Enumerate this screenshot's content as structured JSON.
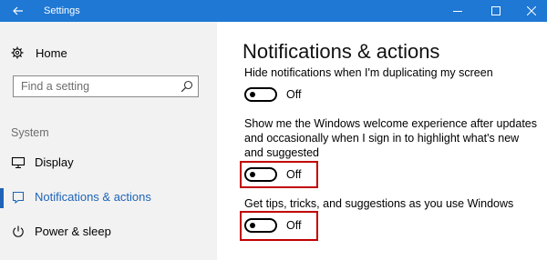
{
  "window": {
    "title": "Settings"
  },
  "sidebar": {
    "home_label": "Home",
    "search_placeholder": "Find a setting",
    "section_label": "System",
    "items": [
      {
        "label": "Display"
      },
      {
        "label": "Notifications & actions"
      },
      {
        "label": "Power & sleep"
      }
    ]
  },
  "main": {
    "title": "Notifications & actions",
    "settings": [
      {
        "description": "Hide notifications when I'm duplicating my screen",
        "state": "Off"
      },
      {
        "description": "Show me the Windows welcome experience after updates and occasionally when I sign in to highlight what's new and suggested",
        "state": "Off"
      },
      {
        "description": "Get tips, tricks, and suggestions as you use Windows",
        "state": "Off"
      }
    ]
  },
  "colors": {
    "titlebar": "#1e78d4",
    "sidebar_bg": "#f2f2f2",
    "accent": "#1e63b8",
    "highlight": "#c00000"
  }
}
